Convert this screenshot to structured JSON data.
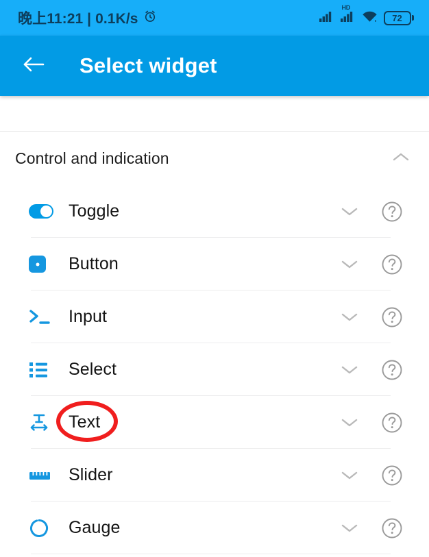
{
  "statusbar": {
    "time_text": "晚上11:21 | 0.1K/s",
    "alarm_icon": "alarm-clock-icon",
    "signal_icon": "cellular-signal-icon",
    "hd_label": "HD",
    "signal2_icon": "cellular-signal-2-icon",
    "wifi_icon": "wifi-icon",
    "battery_level": "72",
    "bg_color": "#17AEF9"
  },
  "appbar": {
    "back_icon": "back-arrow-icon",
    "title": "Select widget",
    "bg_color": "#029BE5"
  },
  "section": {
    "title": "Control and indication",
    "collapse_icon": "chevron-up-icon",
    "expanded": true
  },
  "widgets": [
    {
      "label": "Toggle",
      "icon": "toggle-switch-icon",
      "expand_icon": "chevron-down-icon",
      "help_icon": "question-mark-icon"
    },
    {
      "label": "Button",
      "icon": "button-square-icon",
      "expand_icon": "chevron-down-icon",
      "help_icon": "question-mark-icon"
    },
    {
      "label": "Input",
      "icon": "terminal-prompt-icon",
      "expand_icon": "chevron-down-icon",
      "help_icon": "question-mark-icon"
    },
    {
      "label": "Select",
      "icon": "bulleted-list-icon",
      "expand_icon": "chevron-down-icon",
      "help_icon": "question-mark-icon"
    },
    {
      "label": "Text",
      "icon": "text-width-icon",
      "expand_icon": "chevron-down-icon",
      "help_icon": "question-mark-icon"
    },
    {
      "label": "Slider",
      "icon": "ruler-icon",
      "expand_icon": "chevron-down-icon",
      "help_icon": "question-mark-icon"
    },
    {
      "label": "Gauge",
      "icon": "gauge-circle-icon",
      "expand_icon": "chevron-down-icon",
      "help_icon": "question-mark-icon"
    }
  ],
  "annotation": {
    "shape": "ellipse",
    "color": "#F01E1E",
    "targets": "Text"
  },
  "theme": {
    "accent": "#029BE5",
    "icon_blue": "#1597E0",
    "divider": "#ececed",
    "text_primary": "#141414"
  }
}
